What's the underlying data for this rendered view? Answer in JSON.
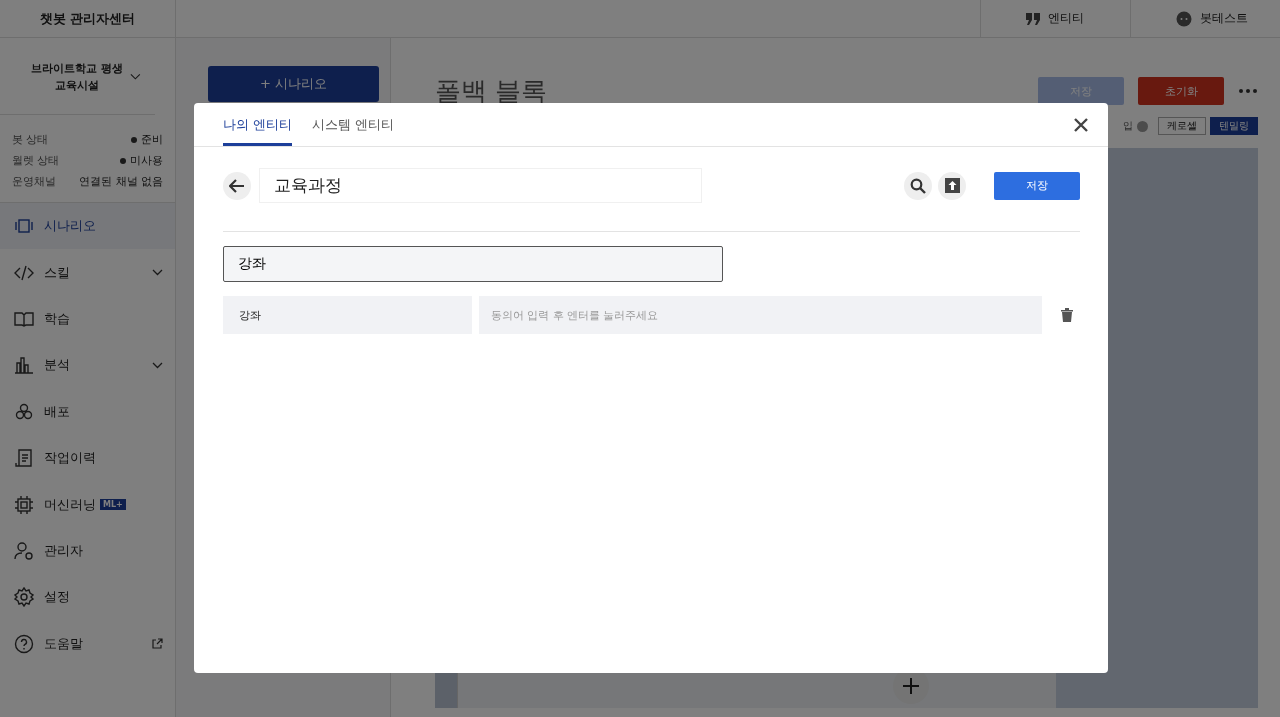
{
  "app_title": "챗봇 관리자센터",
  "header_links": [
    {
      "label": "엔티티"
    },
    {
      "label": "봇테스트"
    }
  ],
  "bot_name": "브라이트학교 평생교육시설",
  "status": [
    {
      "label": "봇 상태",
      "value": "준비",
      "dot": true
    },
    {
      "label": "월렛 상태",
      "value": "미사용",
      "dot": true
    },
    {
      "label": "운영채널",
      "value": "연결된 채널 없음",
      "dot": false
    }
  ],
  "nav": [
    {
      "label": "시나리오",
      "selected": true,
      "expandable": false
    },
    {
      "label": "스킬",
      "selected": false,
      "expandable": true
    },
    {
      "label": "학습",
      "selected": false,
      "expandable": false
    },
    {
      "label": "분석",
      "selected": false,
      "expandable": true
    },
    {
      "label": "배포",
      "selected": false,
      "expandable": false
    },
    {
      "label": "작업이력",
      "selected": false,
      "expandable": false
    },
    {
      "label": "머신러닝",
      "selected": false,
      "expandable": false,
      "badge": "ML+"
    },
    {
      "label": "관리자",
      "selected": false,
      "expandable": false
    },
    {
      "label": "설정",
      "selected": false,
      "expandable": false
    },
    {
      "label": "도움말",
      "selected": false,
      "expandable": false,
      "external": true
    }
  ],
  "add_scenario_button": "+ 시나리오",
  "block_title": "폴백 블록",
  "block_buttons": [
    {
      "label": "저장",
      "kind": "disabled"
    },
    {
      "label": "초기화",
      "kind": "danger"
    }
  ],
  "view_toggle": [
    {
      "label": "케로셀",
      "selected": false
    },
    {
      "label": "텐밀링",
      "selected": true
    }
  ],
  "view_toggle_label": "입",
  "modal": {
    "tabs": [
      {
        "label": "나의 엔티티",
        "selected": true
      },
      {
        "label": "시스템 엔티티",
        "selected": false
      }
    ],
    "entity_name": "교육과정",
    "save_button": "저장",
    "value_input": "강좌",
    "entries": [
      {
        "value": "강좌",
        "synonyms_placeholder": "동의어 입력 후 엔터를 눌러주세요"
      }
    ]
  }
}
